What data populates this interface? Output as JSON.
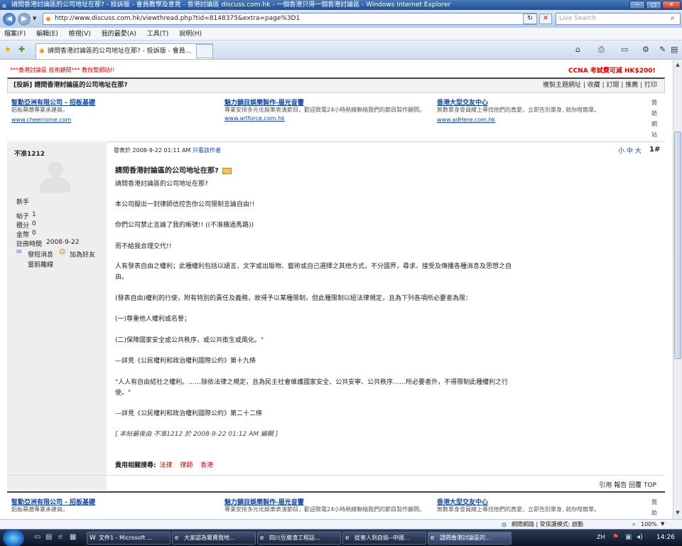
{
  "window": {
    "title": "請問香港討論區的公司地址在那? - 投訴版 - 會員教學及意見 - 香港討論區 discuss.com.hk - 一個香港只得一個香港討論區 - Windows Internet Explorer",
    "minimize": "─",
    "maximize": "□",
    "close": "✕"
  },
  "address": {
    "url": "http://www.discuss.com.hk/viewthread.php?tid=8148375&extra=page%3D1",
    "search_placeholder": "Live Search"
  },
  "menu": [
    "檔案(F)",
    "編輯(E)",
    "檢視(V)",
    "我的最愛(A)",
    "工具(T)",
    "說明(H)"
  ],
  "tab": {
    "label": "請問香港討論區的公司地址在那? - 投訴版 - 會員..."
  },
  "page": {
    "top_left_banner": "***香港討論區 技術顧問*** 教你整網站!!",
    "top_right_banner": "CCNA 考試費可減 HK$200!",
    "thread_title": "[投訴] 請問香港討論區的公司地址在那?",
    "thread_actions": "複製主題網址 | 收藏 | 訂閱 | 推薦 | 打印",
    "ads": [
      {
        "title": "智勤亞洲有限公司 - 招板基礎",
        "desc": "鋁板幕牆專業承建商。",
        "url": "www.cheerrome.com"
      },
      {
        "title": "魅力韻目娛樂製作-眉光音響",
        "desc": "專業安排多元化娛樂表演節目，歡迎致電24小時熱線聯絡我們的節目製作顧問。",
        "url": "www.artforce.com.hk"
      },
      {
        "title": "香港大型交友中心",
        "desc": "無數單身會員線上尋找他們的真愛，立即告別單身, 就你咁簡單。",
        "url": "www.adHere.com.hk"
      }
    ],
    "side_label": "贊助網站",
    "bottom_side_label": "贊助",
    "user": {
      "name": "不准1212",
      "rank": "新手",
      "posts_label": "帖子",
      "posts": "1",
      "points_label": "積分",
      "points": "0",
      "money_label": "金幣",
      "money": "0",
      "reg_label": "註冊時間",
      "reg": "2008-9-22",
      "sms": "發短消息",
      "add_friend": "加為好友",
      "status": "當前離線"
    },
    "post": {
      "meta": "發表於 2008-9-22 01:11 AM",
      "only_author": "只看該作者",
      "font_size": "小 中 大",
      "floor": "1#",
      "title": "請問香港討論區的公司地址在那?",
      "lines": [
        "請問香港討論區的公司地址在那?",
        "本公司擬出一封律師信控告你公司限制言論自由!!",
        "你們公司禁止言論了我的帳號!! ((不准橫過馬路))",
        "而不給我合理交代!!",
        "人有發表自由之權利；此種權利包括以語言、文字或出版物、藝術或自己選擇之其他方式，不分國界，尋求、接受及傳播各種消息及思想之自",
        "由。",
        "(發表自由)權利的行使，附有特別的責任及義務，故得予以某種限制，但此種限制以經法律規定，且為下列各項所必要者為限：",
        "(一)尊重他人權利或名譽；",
        "(二)保障國家安全或公共秩序，或公共衛生或風化。\"",
        "—詳見《公民權利和政治權利國際公約》第十九條",
        "\"人人有自由結社之權利。……除依法律之規定，且為民主社會維護國家安全、公共安寧、公共秩序……所必要者外，不得限制此種權利之行",
        "使。\"",
        "—詳見《公民權利和政治權利國際公約》第二十二條"
      ],
      "edit_note": "[ 本帖最後由 不准1212 於 2008-9-22 01:12 AM 編輯 ]",
      "tags_label": "貴用相關搜尋:",
      "tags": [
        "法律",
        "律師",
        "香港"
      ],
      "actions": "引用 報告 回覆 TOP"
    }
  },
  "status": {
    "zone": "網際網路 | 受保護模式: 啟動",
    "zoom": "100%"
  },
  "taskbar": {
    "items": [
      "文件1 - Microsoft ...",
      "大家認為實賣我地...",
      "四川豆腐渣工程話...",
      "從害人到自毀--中國...",
      "請問香港討論區的..."
    ],
    "lang": "ZH",
    "time": "14:26"
  }
}
